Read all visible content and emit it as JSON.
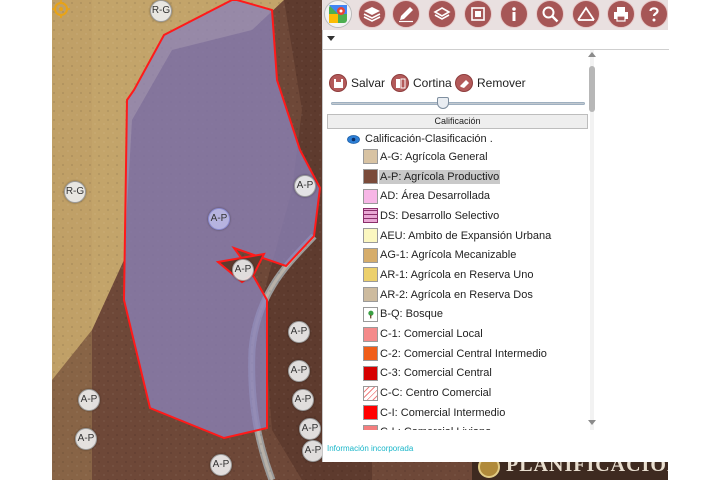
{
  "toolbar": {
    "tools": [
      {
        "id": "gmaps",
        "icon": "google-maps-icon"
      },
      {
        "id": "layers",
        "icon": "layers-icon"
      },
      {
        "id": "edit",
        "icon": "pencil-icon"
      },
      {
        "id": "layers-stack",
        "icon": "stacked-layers-icon"
      },
      {
        "id": "map-export",
        "icon": "map-export-icon"
      },
      {
        "id": "info",
        "icon": "info-icon"
      },
      {
        "id": "search",
        "icon": "magnifier-icon"
      },
      {
        "id": "measure",
        "icon": "measure-icon"
      },
      {
        "id": "print",
        "icon": "printer-icon"
      },
      {
        "id": "help",
        "icon": "help-icon"
      }
    ]
  },
  "panel": {
    "actions": {
      "save": "Salvar",
      "curtain": "Cortina",
      "remove": "Remover"
    },
    "slider": {
      "value": 0.44
    },
    "section_title": "Calificación",
    "group_title": "Calificación-Clasificación .",
    "legend": [
      {
        "label": "A-G: Agrícola General",
        "color": "#d8c3a3",
        "pattern": "solid"
      },
      {
        "label": "A-P: Agrícola Productivo",
        "color": "#7a4b3a",
        "pattern": "solid",
        "highlighted": true
      },
      {
        "label": "AD: Área Desarrollada",
        "color": "#f7b6e6",
        "pattern": "solid"
      },
      {
        "label": "DS: Desarrollo Selectivo",
        "color": "#e9a8d4",
        "pattern": "hatch-purple"
      },
      {
        "label": "AEU: Ambito de Expansión Urbana",
        "color": "#fbf7c0",
        "pattern": "solid"
      },
      {
        "label": "AG-1: Agrícola Mecanizable",
        "color": "#d6ad6b",
        "pattern": "solid"
      },
      {
        "label": "AR-1: Agrícola en Reserva Uno",
        "color": "#ecd06c",
        "pattern": "solid"
      },
      {
        "label": "AR-2: Agrícola en Reserva Dos",
        "color": "#cdbb9f",
        "pattern": "solid"
      },
      {
        "label": "B-Q: Bosque",
        "color": "#ffffff",
        "pattern": "tree"
      },
      {
        "label": "C-1: Comercial Local",
        "color": "#f48a8a",
        "pattern": "solid"
      },
      {
        "label": "C-2: Comercial Central Intermedio",
        "color": "#f05d18",
        "pattern": "solid"
      },
      {
        "label": "C-3: Comercial Central",
        "color": "#d60000",
        "pattern": "solid"
      },
      {
        "label": "C-C: Centro Comercial",
        "color": "#ffffff",
        "pattern": "hatch-red"
      },
      {
        "label": "C-I: Comercial Intermedio",
        "color": "#ff0000",
        "pattern": "solid"
      },
      {
        "label": "C-L: Comercial Liviano",
        "color": "#f47e7e",
        "pattern": "solid"
      },
      {
        "label": "",
        "color": "#f06a1e",
        "pattern": "solid"
      }
    ],
    "footer_link": "Información incorporada"
  },
  "map": {
    "labels": [
      {
        "id": "rg-top",
        "text": "R-G"
      },
      {
        "id": "rg-mid",
        "text": "R-G"
      },
      {
        "id": "ap-sel",
        "text": "A-P",
        "selected": true
      },
      {
        "id": "ap-r1",
        "text": "A-P"
      },
      {
        "id": "ap-in",
        "text": "A-P"
      },
      {
        "id": "ap-r2",
        "text": "A-P"
      },
      {
        "id": "ap-r3",
        "text": "A-P"
      },
      {
        "id": "ap-r4",
        "text": "A-P"
      },
      {
        "id": "ap-r5",
        "text": "A-P"
      },
      {
        "id": "ap-r6",
        "text": "A-P"
      },
      {
        "id": "ap-l1",
        "text": "A-P"
      },
      {
        "id": "ap-l2",
        "text": "A-P"
      },
      {
        "id": "ap-b1",
        "text": "A-P"
      }
    ],
    "logo_text": "PLANIFICACIÓN"
  },
  "colors": {
    "accent": "#a65656",
    "parcel_outline": "#ff0000",
    "parcel_fill": "#8b82b8",
    "link": "#19b6c9"
  }
}
